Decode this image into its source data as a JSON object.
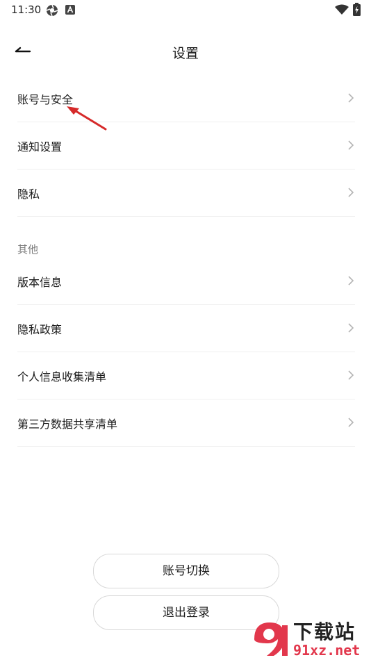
{
  "status_bar": {
    "time": "11:30",
    "left_icons": [
      "aperture-icon",
      "a-letter-icon"
    ],
    "right_icons": [
      "wifi-icon",
      "battery-charging-icon"
    ]
  },
  "header": {
    "title": "设置",
    "back_icon": "back-arrow-icon"
  },
  "account_section": {
    "items": [
      {
        "label": "账号与安全",
        "icon": "chevron-right-icon"
      },
      {
        "label": "通知设置",
        "icon": "chevron-right-icon"
      },
      {
        "label": "隐私",
        "icon": "chevron-right-icon"
      }
    ]
  },
  "other_section": {
    "title": "其他",
    "items": [
      {
        "label": "版本信息",
        "icon": "chevron-right-icon"
      },
      {
        "label": "隐私政策",
        "icon": "chevron-right-icon"
      },
      {
        "label": "个人信息收集清单",
        "icon": "chevron-right-icon"
      },
      {
        "label": "第三方数据共享清单",
        "icon": "chevron-right-icon"
      }
    ]
  },
  "buttons": {
    "switch_account": "账号切换",
    "logout": "退出登录"
  },
  "annotation": {
    "icon": "red-arrow-icon",
    "color": "#d62a2a"
  },
  "watermark": {
    "title": "下载站",
    "url": "91xz.net",
    "brand_color": "#e2374c"
  }
}
